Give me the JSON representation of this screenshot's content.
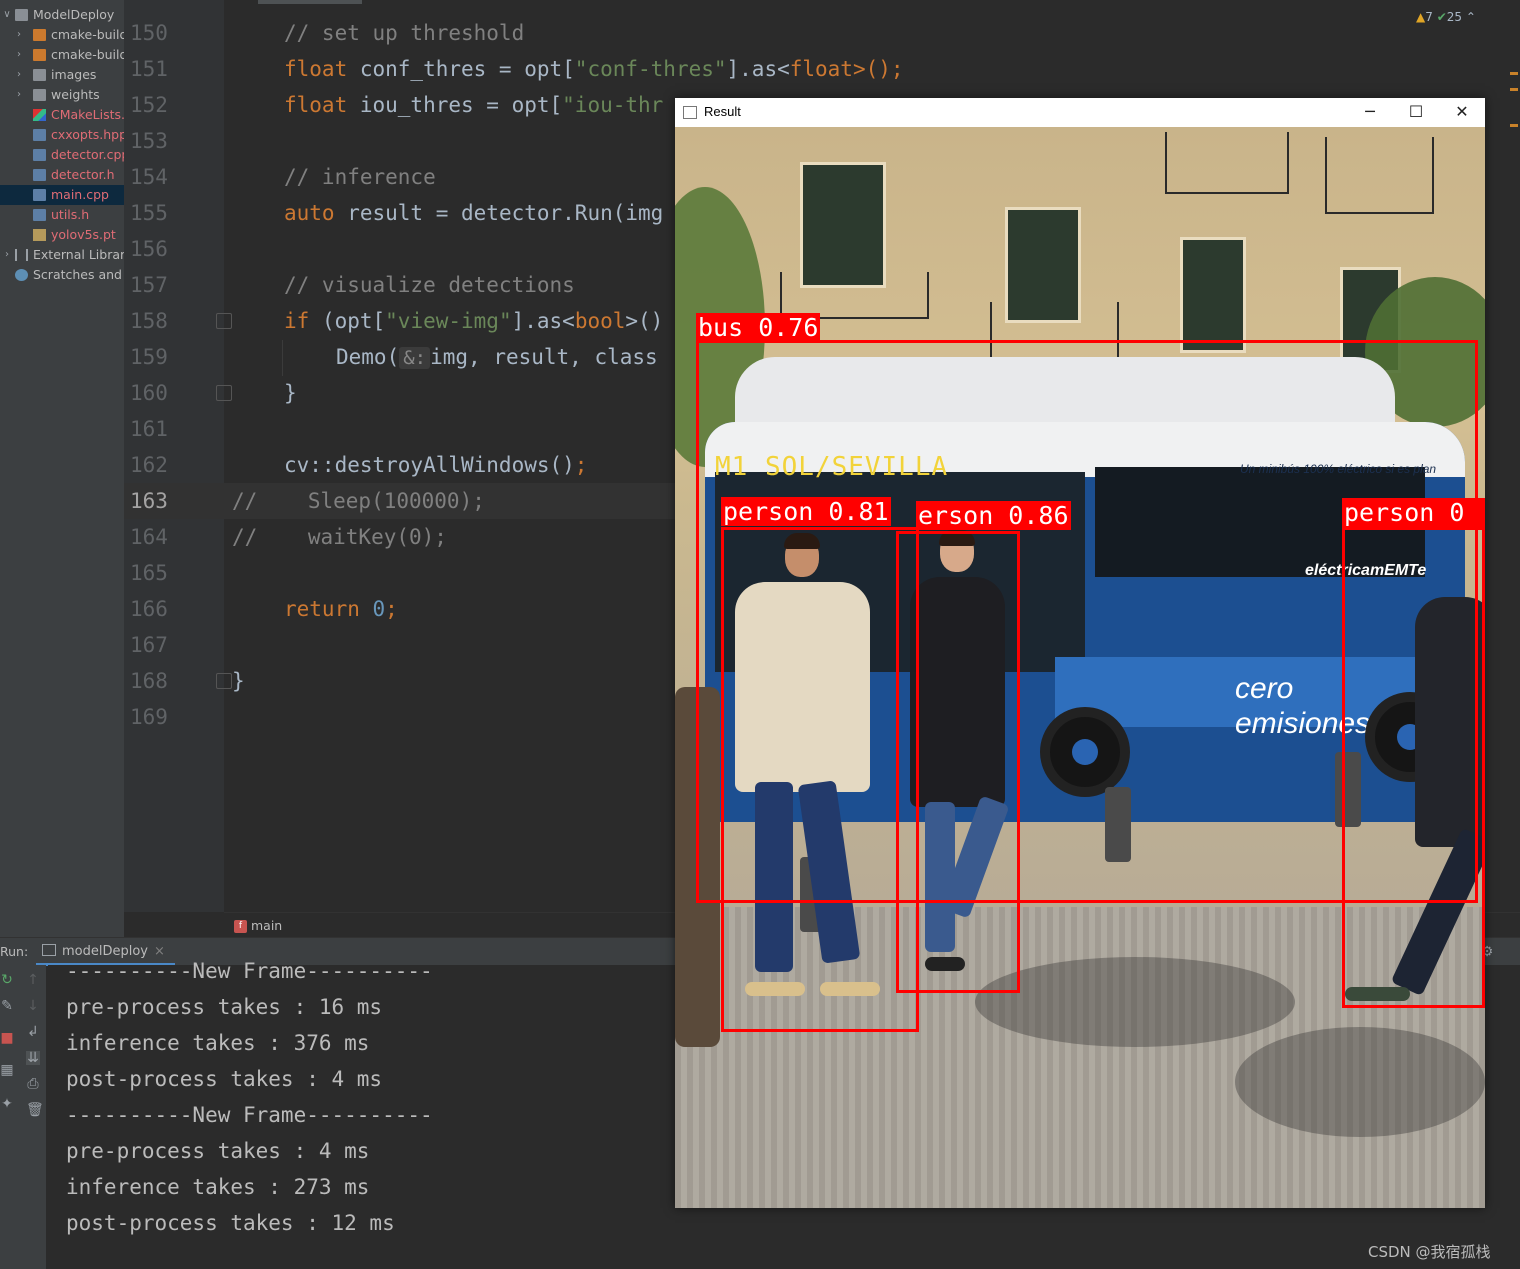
{
  "project_tree": {
    "items": [
      {
        "label": "ModelDeploy",
        "arrow": "∨",
        "kind": "folder-gray"
      },
      {
        "label": "cmake-build",
        "arrow": "›",
        "kind": "folder-orange"
      },
      {
        "label": "cmake-build",
        "arrow": "›",
        "kind": "folder-orange"
      },
      {
        "label": "images",
        "arrow": "›",
        "kind": "folder-gray"
      },
      {
        "label": "weights",
        "arrow": "›",
        "kind": "folder-gray"
      },
      {
        "label": "CMakeLists.t",
        "arrow": "",
        "kind": "file-cmake"
      },
      {
        "label": "cxxopts.hpp",
        "arrow": "",
        "kind": "file"
      },
      {
        "label": "detector.cpp",
        "arrow": "",
        "kind": "file"
      },
      {
        "label": "detector.h",
        "arrow": "",
        "kind": "file"
      },
      {
        "label": "main.cpp",
        "arrow": "",
        "kind": "file"
      },
      {
        "label": "utils.h",
        "arrow": "",
        "kind": "file"
      },
      {
        "label": "yolov5s.pt",
        "arrow": "",
        "kind": "file-pt"
      },
      {
        "label": "External Librarie",
        "arrow": "›",
        "kind": "libs"
      },
      {
        "label": "Scratches and C",
        "arrow": "",
        "kind": "scratch"
      }
    ],
    "selected": "main.cpp"
  },
  "editor": {
    "line_numbers": [
      "150",
      "151",
      "152",
      "153",
      "154",
      "155",
      "156",
      "157",
      "158",
      "159",
      "160",
      "161",
      "162",
      "163",
      "164",
      "165",
      "166",
      "167",
      "168",
      "169"
    ],
    "current_line": "163",
    "lines": {
      "l150_comment": "// set up threshold",
      "l151_float": "float",
      "l151_var": " conf_thres = opt[",
      "l151_str": "\"conf-thres\"",
      "l151_mid": "].as<",
      "l151_type": "float",
      "l151_end": ">();",
      "l152_float": "float",
      "l152_var": " iou_thres = opt[",
      "l152_str": "\"iou-thr",
      "l154_comment": "// inference",
      "l155_kw": "auto",
      "l155_rest": " result = detector.Run(img",
      "l157_comment": "// visualize detections",
      "l158_kw": "if",
      "l158_a": " (opt[",
      "l158_str": "\"view-img\"",
      "l158_b": "].as<",
      "l158_type": "bool",
      "l158_c": ">()",
      "l159_fn": "Demo(",
      "l159_hint": "&:",
      "l159_rest": "img, result, class",
      "l160_brace": "}",
      "l162_call": "cv::destroyAllWindows()",
      "l162_semi": ";",
      "l163_comment": "//    Sleep(100000);",
      "l164_comment": "//    waitKey(0);",
      "l166_kw": "return",
      "l166_num": "0",
      "l166_semi": ";",
      "l168_brace": "}"
    },
    "inspections": {
      "warnings": "7",
      "ok": "25"
    },
    "breadcrumb": "main"
  },
  "run_panel": {
    "label": "Run:",
    "tab": "modelDeploy",
    "output": [
      "----------New Frame----------",
      "pre-process takes : 16 ms",
      "inference takes : 376 ms",
      "post-process takes : 4 ms",
      "----------New Frame----------",
      "pre-process takes : 4 ms",
      "inference takes : 273 ms",
      "post-process takes : 12 ms"
    ]
  },
  "result_window": {
    "title": "Result",
    "bus_destination": "M1 SOL/SEVILLA",
    "bus_slogan": "Un minibús 100% eléctrico si es plan",
    "bus_brand": "eléctricamEMTe",
    "bus_emisiones_1": "cero",
    "bus_emisiones_2": "emisiones",
    "detections": [
      {
        "label": "bus 0.76"
      },
      {
        "label": "person 0.81"
      },
      {
        "label": "erson 0.86"
      },
      {
        "label": "person 0"
      }
    ]
  },
  "watermark": "CSDN @我宿孤栈",
  "colors": {
    "detection": "#ff0000",
    "accent": "#4a88c7"
  }
}
